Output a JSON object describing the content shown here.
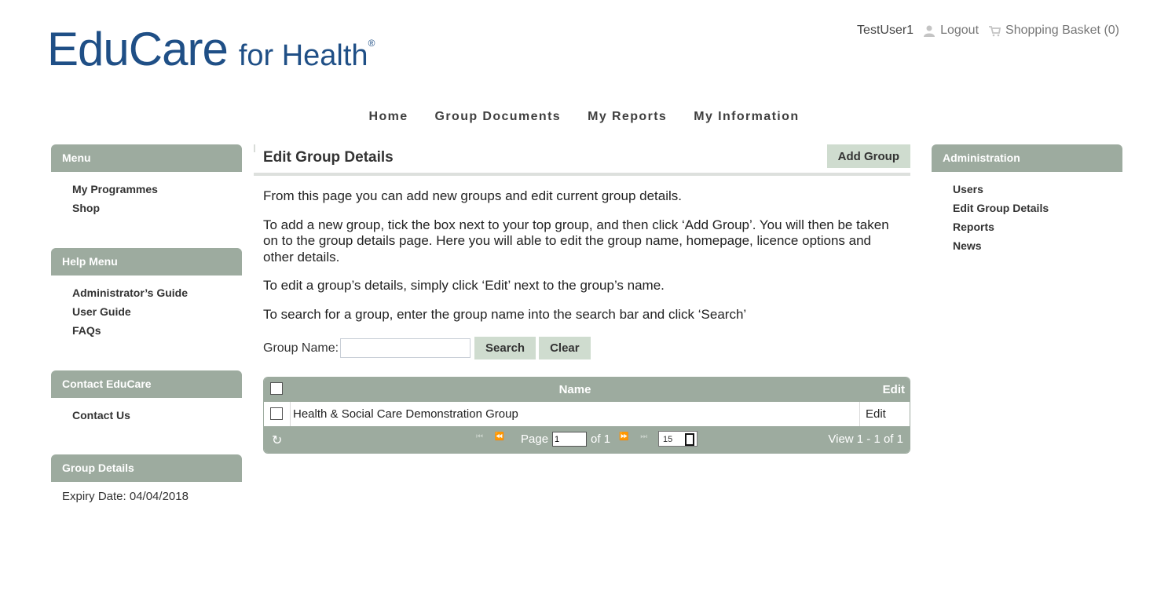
{
  "header": {
    "logo_main": "EduCare",
    "logo_sub": "for Health",
    "logo_mark": "®",
    "username": "TestUser1",
    "logout": "Logout",
    "basket": "Shopping Basket (0)"
  },
  "nav": [
    "Home",
    "Group Documents",
    "My Reports",
    "My Information"
  ],
  "left_panels": {
    "menu": {
      "title": "Menu",
      "items": [
        "My Programmes",
        "Shop"
      ]
    },
    "help": {
      "title": "Help Menu",
      "items": [
        "Administrator’s Guide",
        "User Guide",
        "FAQs"
      ]
    },
    "contact": {
      "title": "Contact EduCare",
      "items": [
        "Contact Us"
      ]
    },
    "group": {
      "title": "Group Details",
      "expiry": "Expiry Date: 04/04/2018"
    }
  },
  "admin": {
    "title": "Administration",
    "items": [
      "Users",
      "Edit Group Details",
      "Reports",
      "News"
    ]
  },
  "content": {
    "title": "Edit Group Details",
    "add_group": "Add Group",
    "p1": "From this page you can add new groups and edit current group details.",
    "p2": "To add a new group, tick the box next to your top group, and then click ‘Add Group’. You will then be taken on to the group details page. Here you will able to edit the group name, homepage, licence options and other details.",
    "p3": "To edit a group’s details, simply click ‘Edit’ next to the group’s name.",
    "p4": "To search for a group, enter the group name into the search bar and click ‘Search’",
    "search_label": "Group Name:",
    "search_value": "",
    "search_btn": "Search",
    "clear_btn": "Clear"
  },
  "grid": {
    "col_name": "Name",
    "col_edit": "Edit",
    "rows": [
      {
        "name": "Health & Social Care Demonstration Group",
        "edit": "Edit"
      }
    ],
    "pager": {
      "page_label": "Page",
      "page_value": "1",
      "of": "of 1",
      "rows_per_page": "15",
      "view": "View 1 - 1 of 1"
    }
  }
}
